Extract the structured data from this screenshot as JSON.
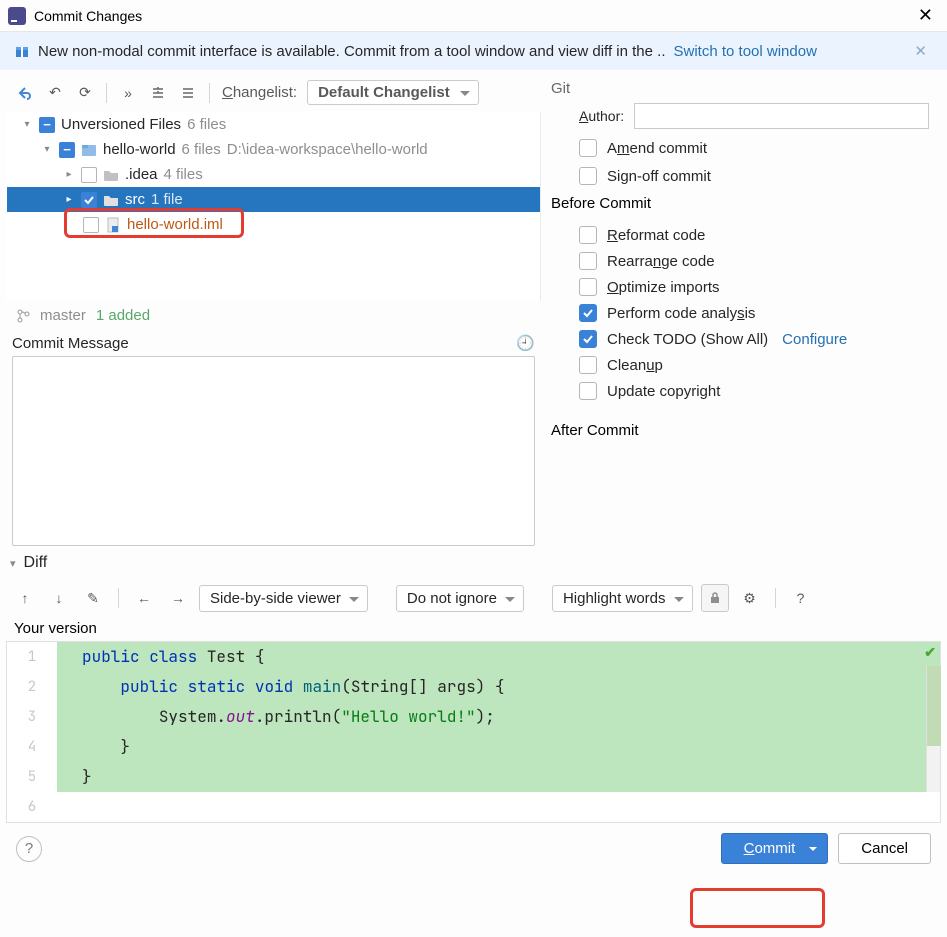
{
  "titlebar": {
    "title": "Commit Changes"
  },
  "banner": {
    "text": "New non-modal commit interface is available. Commit from a tool window and view diff in the ..",
    "link": "Switch to tool window"
  },
  "toolbar": {
    "changelist_label": "Changelist:",
    "changelist_value": "Default Changelist"
  },
  "tree": {
    "root": {
      "label": "Unversioned Files",
      "count": "6 files"
    },
    "module": {
      "label": "hello-world",
      "count": "6 files",
      "path": "D:\\idea-workspace\\hello-world"
    },
    "idea": {
      "label": ".idea",
      "count": "4 files"
    },
    "src": {
      "label": "src",
      "count": "1 file"
    },
    "iml": {
      "label": "hello-world.iml"
    }
  },
  "branch": {
    "name": "master",
    "added": "1 added"
  },
  "commit_msg": {
    "label": "Commit Message"
  },
  "git": {
    "header": "Git",
    "author_label": "Author:",
    "amend": "Amend commit",
    "signoff": "Sign-off commit"
  },
  "before": {
    "header": "Before Commit",
    "reformat": "Reformat code",
    "rearrange": "Rearrange code",
    "optimize": "Optimize imports",
    "analysis": "Perform code analysis",
    "todo": "Check TODO (Show All)",
    "todo_link": "Configure",
    "cleanup": "Cleanup",
    "copyright": "Update copyright"
  },
  "after": {
    "header": "After Commit"
  },
  "diff": {
    "label": "Diff",
    "viewer": "Side-by-side viewer",
    "ignore": "Do not ignore",
    "highlight": "Highlight words",
    "version": "Your version"
  },
  "code": {
    "l1a": "public",
    "l1b": "class",
    "l1c": " Test {",
    "l2a": "public",
    "l2b": "static",
    "l2c": "void",
    "l2d": "main",
    "l2e": "(String[] args) {",
    "l3a": "System.",
    "l3b": "out",
    "l3c": ".println(",
    "l3d": "\"Hello world!\"",
    "l3e": ");",
    "l4": "}",
    "l5": "}"
  },
  "footer": {
    "commit": "Commit",
    "cancel": "Cancel"
  }
}
